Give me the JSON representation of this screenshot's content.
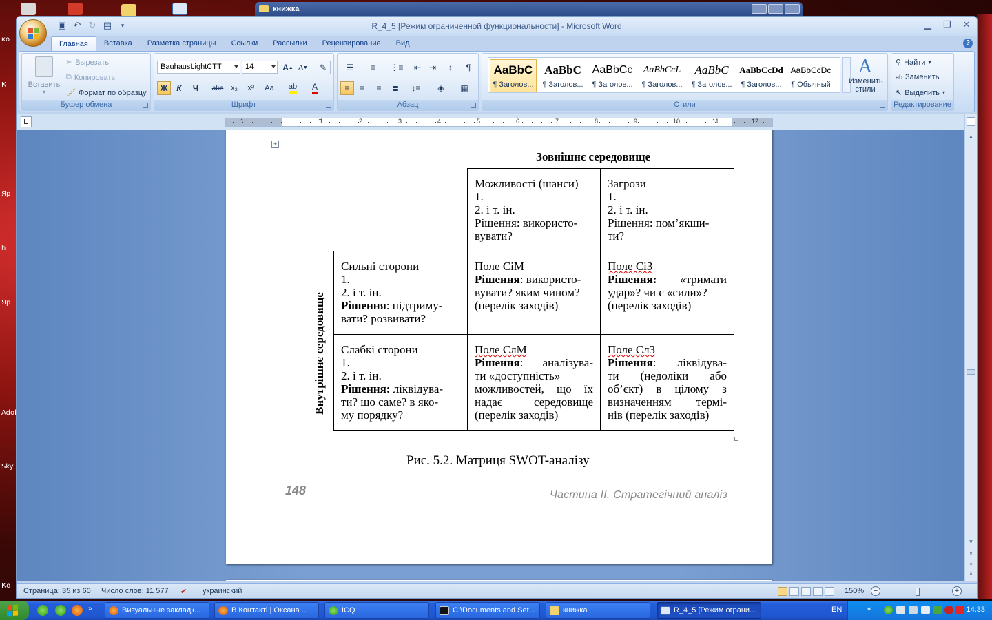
{
  "window": {
    "title": "R_4_5 [Режим ограниченной функциональности] - Microsoft Word",
    "back_window_title": "книжка"
  },
  "ribbon": {
    "tabs": [
      "Главная",
      "Вставка",
      "Разметка страницы",
      "Ссылки",
      "Рассылки",
      "Рецензирование",
      "Вид"
    ],
    "clipboard": {
      "paste": "Вставить",
      "cut": "Вырезать",
      "copy": "Копировать",
      "format_painter": "Формат по образцу",
      "label": "Буфер обмена"
    },
    "font": {
      "name": "BauhausLightCTT",
      "size": "14",
      "label": "Шрифт",
      "bold": "Ж",
      "italic": "К",
      "underline": "Ч",
      "strike": "abe",
      "sub": "x₂",
      "sup": "x²",
      "case": "Aa"
    },
    "paragraph": {
      "label": "Абзац"
    },
    "styles": {
      "label": "Стили",
      "items": [
        {
          "preview": "AaBbC",
          "name": "¶ Заголов..."
        },
        {
          "preview": "AaBbC",
          "name": "¶ Заголов..."
        },
        {
          "preview": "AaBbCc",
          "name": "¶ Заголов..."
        },
        {
          "preview": "AaBbCcL",
          "name": "¶ Заголов..."
        },
        {
          "preview": "AaBbC",
          "name": "¶ Заголов..."
        },
        {
          "preview": "AaBbCcDd",
          "name": "¶ Заголов..."
        },
        {
          "preview": "AaBbCcDc",
          "name": "¶ Обычный"
        }
      ],
      "change": "Изменить стили"
    },
    "editing": {
      "label": "Редактирование",
      "find": "Найти",
      "replace": "Заменить",
      "select": "Выделить"
    }
  },
  "ruler": {
    "numbers": [
      "1",
      "1",
      "1",
      "2",
      "3",
      "4",
      "5",
      "6",
      "7",
      "8",
      "9",
      "10",
      "11",
      "12"
    ]
  },
  "document": {
    "external_heading": "Зовнішнє середовище",
    "internal_heading": "Внутрішнє середовище",
    "cells": {
      "opportunities": [
        "Можливості (шанси)",
        "1.",
        "2. і т. ін.",
        "Рішення: викорис­то-",
        "вувати?"
      ],
      "threats": [
        "Загрози",
        "1.",
        "2. і т. ін.",
        "Рішення: пом’якши-",
        "ти?"
      ],
      "strengths": [
        "Сильні сторони",
        "1.",
        "2. і т. ін.",
        "Рішення",
        ": підтриму-",
        "вати? розвивати?"
      ],
      "weaknesses": [
        "Слабкі сторони",
        "1.",
        "2. і т. ін.",
        "Рішення:",
        " ліквідува-",
        "ти? що саме? в яко-",
        "му порядку?"
      ],
      "sm": [
        "Поле СіМ",
        "Рішення",
        ": викорис­то-",
        "вувати? яким чином?",
        "(перелік заходів)"
      ],
      "st": [
        "Поле СіЗ",
        "Рішення:",
        " «тримати",
        "удар»? чи є «сили»?",
        "(перелік заходів)"
      ],
      "wm": [
        "Поле СлМ",
        "Рішення",
        ": аналізува-",
        "ти «доступність»",
        "можливостей, що їх",
        "надає середовище",
        "(перелік заходів)"
      ],
      "wt": [
        "Поле СлЗ",
        "Рішення",
        ": ліквідува-",
        "ти (недоліки або",
        "об’єкт) в цілому з",
        "визначенням термі-",
        "нів (перелік заходів)"
      ]
    },
    "caption": "Рис. 5.2. Матриця SWOT-аналізу",
    "page_number": "148",
    "footer": "Частина ІІ. Стратегічний аналіз"
  },
  "statusbar": {
    "page": "Страница: 35 из 60",
    "words": "Число слов: 11 577",
    "language": "украинский",
    "zoom": "150%"
  },
  "taskbar": {
    "tasks": [
      "Визуальные закладк...",
      "В Контакті | Оксана ...",
      "ICQ",
      "C:\\Documents and Set...",
      "книжка",
      "R_4_5 [Режим ограни..."
    ],
    "lang": "EN",
    "clock": "14:33"
  },
  "desktop": {
    "labels": [
      "ко",
      "К",
      "Яр",
      "h",
      "Яр",
      "Adob",
      "Sky",
      "Ко"
    ]
  }
}
